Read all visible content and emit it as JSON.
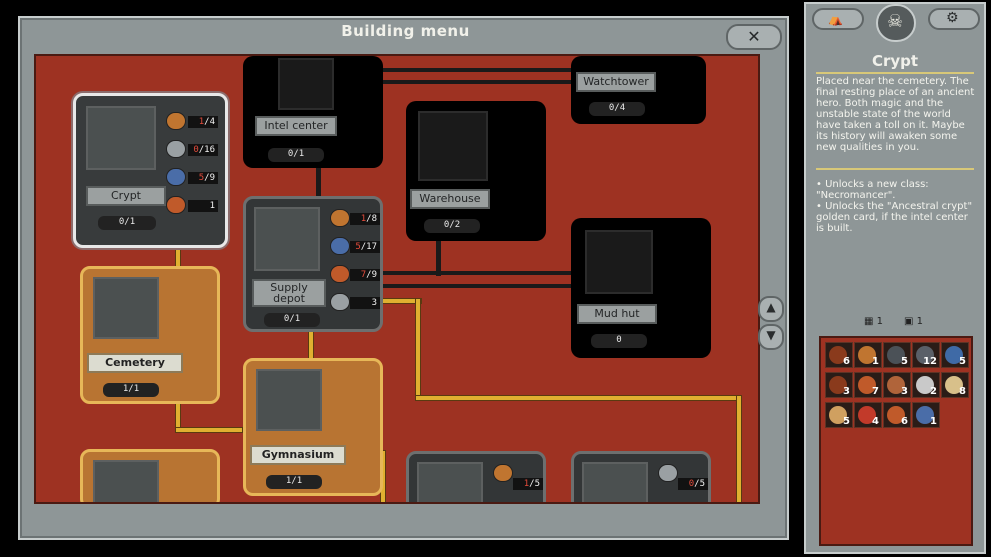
{
  "window": {
    "title": "Building menu",
    "close_icon": "close-x-icon"
  },
  "scroll": {
    "up": "▲",
    "down": "▼"
  },
  "buildings": {
    "crypt": {
      "name": "Crypt",
      "count": "0/1",
      "resources": [
        {
          "icon": "wood-icon",
          "value": "1/4",
          "color": "#c07530"
        },
        {
          "icon": "stone-icon",
          "value": "0/16",
          "color": "#9aa0a3"
        },
        {
          "icon": "metal-icon",
          "value": "5/9",
          "color": "#4a6da8"
        },
        {
          "icon": "food-icon",
          "value": "1",
          "color": "#c05a2a"
        }
      ]
    },
    "intel_center": {
      "name": "Intel center",
      "count": "0/1"
    },
    "watchtower": {
      "name": "Watchtower",
      "count": "0/4"
    },
    "warehouse": {
      "name": "Warehouse",
      "count": "0/2"
    },
    "supply_depot": {
      "name": "Supply depot",
      "count": "0/1",
      "resources": [
        {
          "icon": "wood-icon",
          "value": "1/8",
          "color": "#c07530"
        },
        {
          "icon": "metal-icon",
          "value": "5/17",
          "color": "#4a6da8"
        },
        {
          "icon": "food-icon",
          "value": "7/9",
          "color": "#c05a2a"
        },
        {
          "icon": "stone-icon",
          "value": "3",
          "color": "#9aa0a3"
        }
      ]
    },
    "mud_hut": {
      "name": "Mud hut",
      "count": "0"
    },
    "cemetery": {
      "name": "Cemetery",
      "count": "1/1"
    },
    "gymnasium": {
      "name": "Gymnasium",
      "count": "1/1"
    },
    "bottom_mid": {
      "value": "1/5"
    },
    "bottom_right": {
      "value": "0/5"
    }
  },
  "panel": {
    "title": "Crypt",
    "description": "Placed near the cemetery. The final resting place of an ancient hero. Both magic and the unstable state of the world have taken a toll on it. Maybe its history will awaken some new qualities in you.",
    "bullets": [
      "• Unlocks a new class: \"Necromancer\".",
      "• Unlocks the \"Ancestral crypt\" golden card, if the intel center is built."
    ],
    "stat_a": "1",
    "stat_b": "1",
    "tab_left_icon": "camp-icon",
    "tab_right_icon": "gear-icon"
  },
  "inventory": [
    {
      "icon": "branch-icon",
      "qty": "6",
      "color": "#8a3a1c"
    },
    {
      "icon": "wood-icon",
      "qty": "1",
      "color": "#c07530"
    },
    {
      "icon": "ore-icon",
      "qty": "5",
      "color": "#4b5157"
    },
    {
      "icon": "ore-icon",
      "qty": "12",
      "color": "#5a6068"
    },
    {
      "icon": "crystal-icon",
      "qty": "5",
      "color": "#3f6aa6"
    },
    {
      "icon": "branch-icon",
      "qty": "3",
      "color": "#8a3a1c"
    },
    {
      "icon": "food-icon",
      "qty": "7",
      "color": "#c05a2a"
    },
    {
      "icon": "ore-icon",
      "qty": "3",
      "color": "#b0643a"
    },
    {
      "icon": "skull-icon",
      "qty": "2",
      "color": "#c9c9c9"
    },
    {
      "icon": "scroll-icon",
      "qty": "8",
      "color": "#d8c08a"
    },
    {
      "icon": "book-icon",
      "qty": "5",
      "color": "#d0a060"
    },
    {
      "icon": "potion-icon",
      "qty": "4",
      "color": "#c23a2a"
    },
    {
      "icon": "food-icon",
      "qty": "6",
      "color": "#c05a2a"
    },
    {
      "icon": "orb-icon",
      "qty": "1",
      "color": "#4a6da8"
    }
  ]
}
